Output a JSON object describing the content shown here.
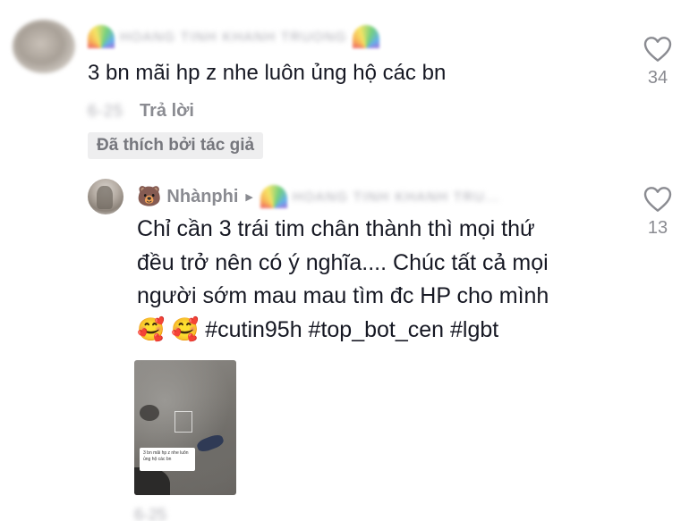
{
  "top_comment": {
    "author": "HOANG TINH KHANH TRUONG",
    "text": "3 bn mãi hp z nhe luôn ủng hộ các bn",
    "date": "6-25",
    "reply_label": "Trả lời",
    "liked_by_author_label": "Đã thích bởi tác giả",
    "like_count": "34"
  },
  "reply": {
    "author_emoji": "🐻",
    "author": "Nhànphi",
    "reply_to": "HOANG TINH KHANH TRU...",
    "text_line1": "Chỉ cần 3 trái tim chân thành thì mọi thứ",
    "text_line2": "đều trở nên có ý nghĩa.... Chúc tất cả mọi",
    "text_line3": "người sớm mau mau tìm đc HP cho mình",
    "emoji1": "🥰",
    "emoji2": "🥰",
    "hashtags": "#cutin95h #top_bot_cen #lgbt",
    "like_count": "13",
    "date": "6-25"
  },
  "thumbnail": {
    "line1": "3 bn mãi hp z nhe luôn",
    "line2": "ủng hộ các bn"
  },
  "icons": {
    "like": "heart-outline-icon",
    "reply_arrow": "triangle-right-icon"
  },
  "colors": {
    "text_primary": "#161823",
    "text_secondary": "#8a8b91",
    "badge_bg": "#eeeeef"
  }
}
